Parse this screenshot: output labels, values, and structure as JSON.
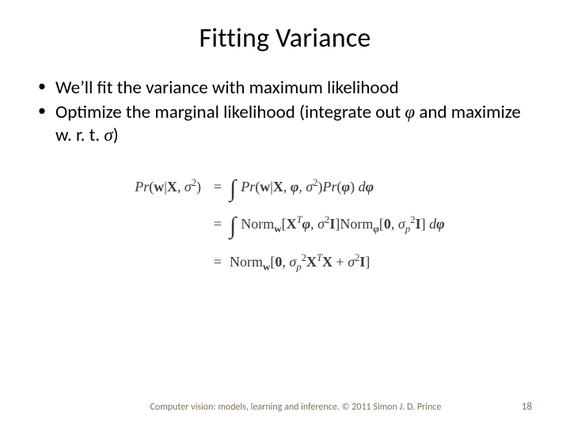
{
  "title": "Fitting Variance",
  "bullets": {
    "b1": "We’ll fit the variance with maximum likelihood",
    "b2_a": "Optimize the marginal likelihood (integrate out ",
    "b2_phi": "φ",
    "b2_b": " and maximize w. r. t. ",
    "b2_sigma": "σ",
    "b2_c": ")"
  },
  "eq": {
    "lhs_pr": "Pr",
    "lhs_open": "(",
    "lhs_w": "w",
    "lhs_bar": "|",
    "lhs_X": "X",
    "lhs_comma": ", ",
    "lhs_sigma2": "σ",
    "lhs_sup2": "2",
    "lhs_close": ")",
    "eq_sign": "=",
    "int": "∫",
    "r1_pr1": "Pr",
    "r1_open1": "(",
    "r1_w": "w",
    "r1_bar": "|",
    "r1_X": "X",
    "r1_c1": ", ",
    "r1_phi": "φ",
    "r1_c2": ", ",
    "r1_sig": "σ",
    "r1_s2": "2",
    "r1_close1": ")",
    "r1_pr2": "Pr",
    "r1_open2": "(",
    "r1_phi2": "φ",
    "r1_close2": ")",
    "r1_dphi_d": " d",
    "r1_dphi_phi": "φ",
    "r2_norm": "Norm",
    "r2_sub_w": "w",
    "r2_brL": "[",
    "r2_X": "X",
    "r2_T": "T",
    "r2_phi": "φ",
    "r2_c": ", ",
    "r2_sig": "σ",
    "r2_s2": "2",
    "r2_I": "I",
    "r2_brR": "]",
    "r2_norm2": "Norm",
    "r2_sub_phi": "φ",
    "r2_br2L": "[",
    "r2_zero": "0",
    "r2_c2": ", ",
    "r2_sigp": "σ",
    "r2_p": "p",
    "r2_s2b": "2",
    "r2_I2": "I",
    "r2_br2R": "]",
    "r2_dphi_d": " d",
    "r2_dphi_phi": "φ",
    "r3_norm": "Norm",
    "r3_sub_w": "w",
    "r3_brL": "[",
    "r3_zero": "0",
    "r3_c": ", ",
    "r3_sigp": "σ",
    "r3_p": "p",
    "r3_s2": "2",
    "r3_X": "X",
    "r3_T": "T",
    "r3_X2": "X",
    "r3_plus": " + ",
    "r3_sig": "σ",
    "r3_s2b": "2",
    "r3_I": "I",
    "r3_brR": "]"
  },
  "footer": {
    "text": "Computer vision: models, learning and inference.  © 2011 Simon J. D. Prince",
    "page": "18"
  }
}
